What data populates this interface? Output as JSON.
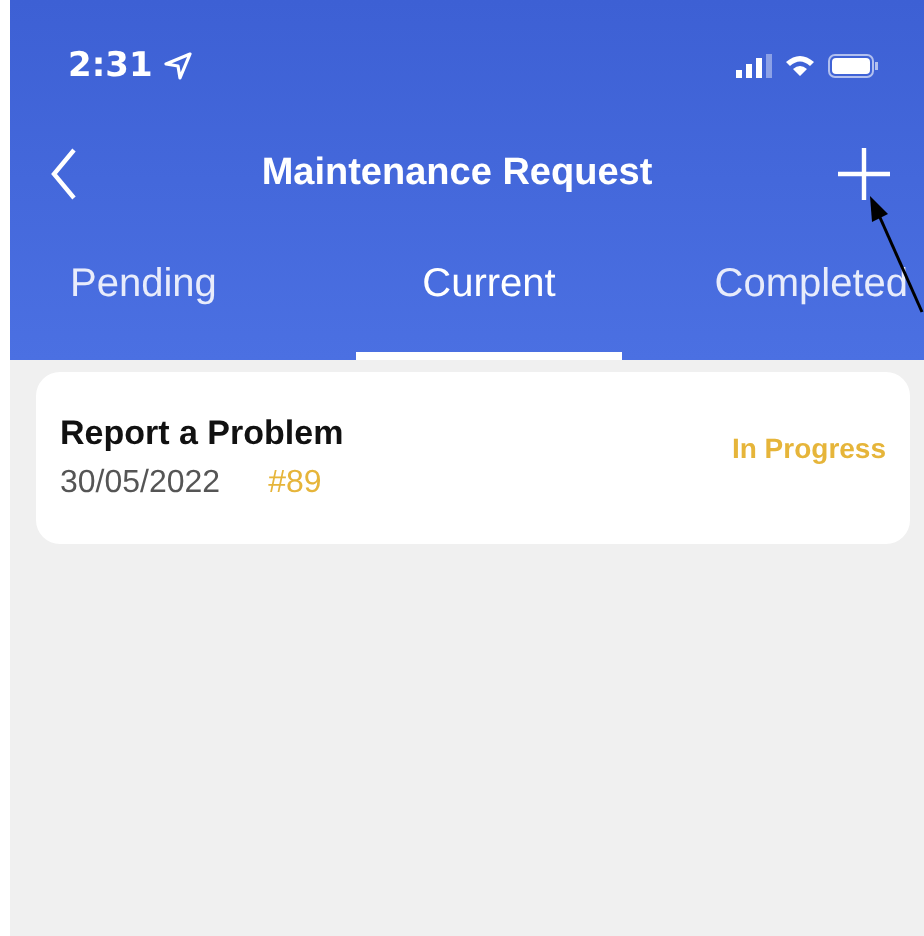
{
  "status_bar": {
    "time": "2:31"
  },
  "nav": {
    "title": "Maintenance Request"
  },
  "tabs": [
    {
      "label": "Pending",
      "selected": false
    },
    {
      "label": "Current",
      "selected": true
    },
    {
      "label": "Completed",
      "selected": false
    }
  ],
  "requests": [
    {
      "title": "Report a Problem",
      "date": "30/05/2022",
      "number": "#89",
      "status": "In Progress"
    }
  ]
}
